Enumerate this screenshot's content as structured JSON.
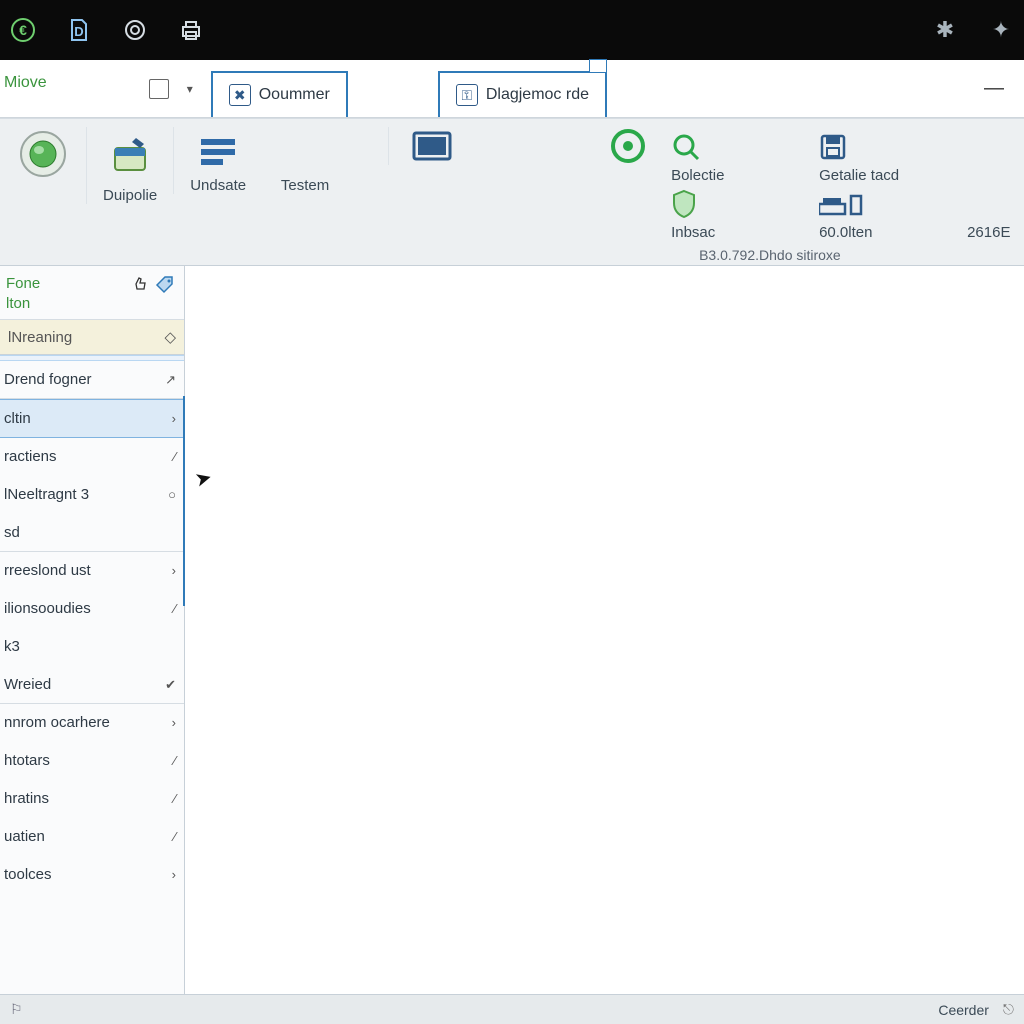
{
  "titlebar": {
    "icons": [
      "app-icon",
      "doc-d-icon",
      "target-icon",
      "printer-icon"
    ],
    "right_icons": [
      "ring-off-icon",
      "pin-icon"
    ]
  },
  "menu": {
    "label": "Miove"
  },
  "tabs": [
    {
      "label": "Ooummer"
    },
    {
      "label": "Dlagjemoc rde"
    }
  ],
  "toolbar": {
    "items": [
      {
        "label": ""
      },
      {
        "label": "Duipolie"
      },
      {
        "label": "Undsate"
      },
      {
        "label": "Testem"
      },
      {
        "label": ""
      },
      {
        "label": ""
      }
    ],
    "right": [
      {
        "label": "Bolectie"
      },
      {
        "label": "Getalie tacd"
      },
      {
        "label": ""
      },
      {
        "label": "Inbsac"
      },
      {
        "label": "60.0lten"
      },
      {
        "label": "2616E"
      }
    ],
    "subtext": "B3.0.792.Dhdo sitiroxe"
  },
  "sidebar": {
    "title_line1": "Fone",
    "title_line2": "lton",
    "section": "lNreaning",
    "items": [
      {
        "label": "Drend fogner",
        "glyph": "↗",
        "bordered": true
      },
      {
        "label": "cltin",
        "glyph": "›",
        "selected": true
      },
      {
        "label": "ractiens",
        "glyph": "∕"
      },
      {
        "label": "lNeeltragnt 3",
        "glyph": "○"
      },
      {
        "label": "sd",
        "glyph": "",
        "bordered": true
      },
      {
        "label": "rreeslond ust",
        "glyph": "›"
      },
      {
        "label": "ilionsooudies",
        "glyph": "∕"
      },
      {
        "label": "k3",
        "glyph": ""
      },
      {
        "label": "Wreied",
        "glyph": "✔",
        "bordered": true
      },
      {
        "label": "nnrom ocarhere",
        "glyph": "›"
      },
      {
        "label": "htotars",
        "glyph": "∕"
      },
      {
        "label": "hratins",
        "glyph": "∕"
      },
      {
        "label": "uatien",
        "glyph": "∕"
      },
      {
        "label": "toolces",
        "glyph": "›"
      }
    ]
  },
  "statusbar": {
    "label": "Ceerder"
  }
}
